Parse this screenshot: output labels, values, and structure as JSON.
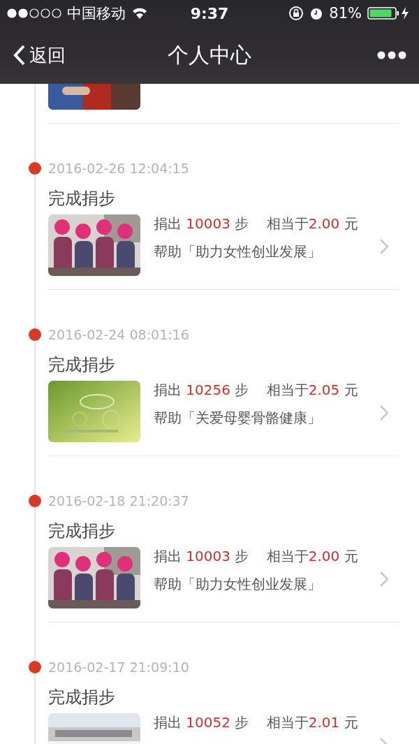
{
  "status_bar": {
    "carrier": "中国移动",
    "time": "9:37",
    "battery": "81%"
  },
  "nav": {
    "back": "返回",
    "title": "个人中心"
  },
  "entries": [
    {
      "thumbnail": {
        "kind": "picture"
      }
    },
    {
      "date": "2016-02-26 12:04:15",
      "title": "完成捐步",
      "thumbnail": {
        "kind": "picture"
      },
      "donation": {
        "prefix": "捐出",
        "steps": "10003",
        "unit": "步",
        "equiv": "相当于",
        "amount": "2.00",
        "currency": "元"
      },
      "project": "帮助「助力女性创业发展」"
    },
    {
      "date": "2016-02-24 08:01:16",
      "title": "完成捐步",
      "thumbnail": {
        "kind": "picture"
      },
      "donation": {
        "prefix": "捐出",
        "steps": "10256",
        "unit": "步",
        "equiv": "相当于",
        "amount": "2.05",
        "currency": "元"
      },
      "project": "帮助「关爱母婴骨骼健康」"
    },
    {
      "date": "2016-02-18 21:20:37",
      "title": "完成捐步",
      "thumbnail": {
        "kind": "picture"
      },
      "donation": {
        "prefix": "捐出",
        "steps": "10003",
        "unit": "步",
        "equiv": "相当于",
        "amount": "2.00",
        "currency": "元"
      },
      "project": "帮助「助力女性创业发展」"
    },
    {
      "date": "2016-02-17 21:09:10",
      "title": "完成捐步",
      "thumbnail": {
        "kind": "picture"
      },
      "donation": {
        "prefix": "捐出",
        "steps": "10052",
        "unit": "步",
        "equiv": "相当于",
        "amount": "2.01",
        "currency": "元"
      }
    }
  ]
}
